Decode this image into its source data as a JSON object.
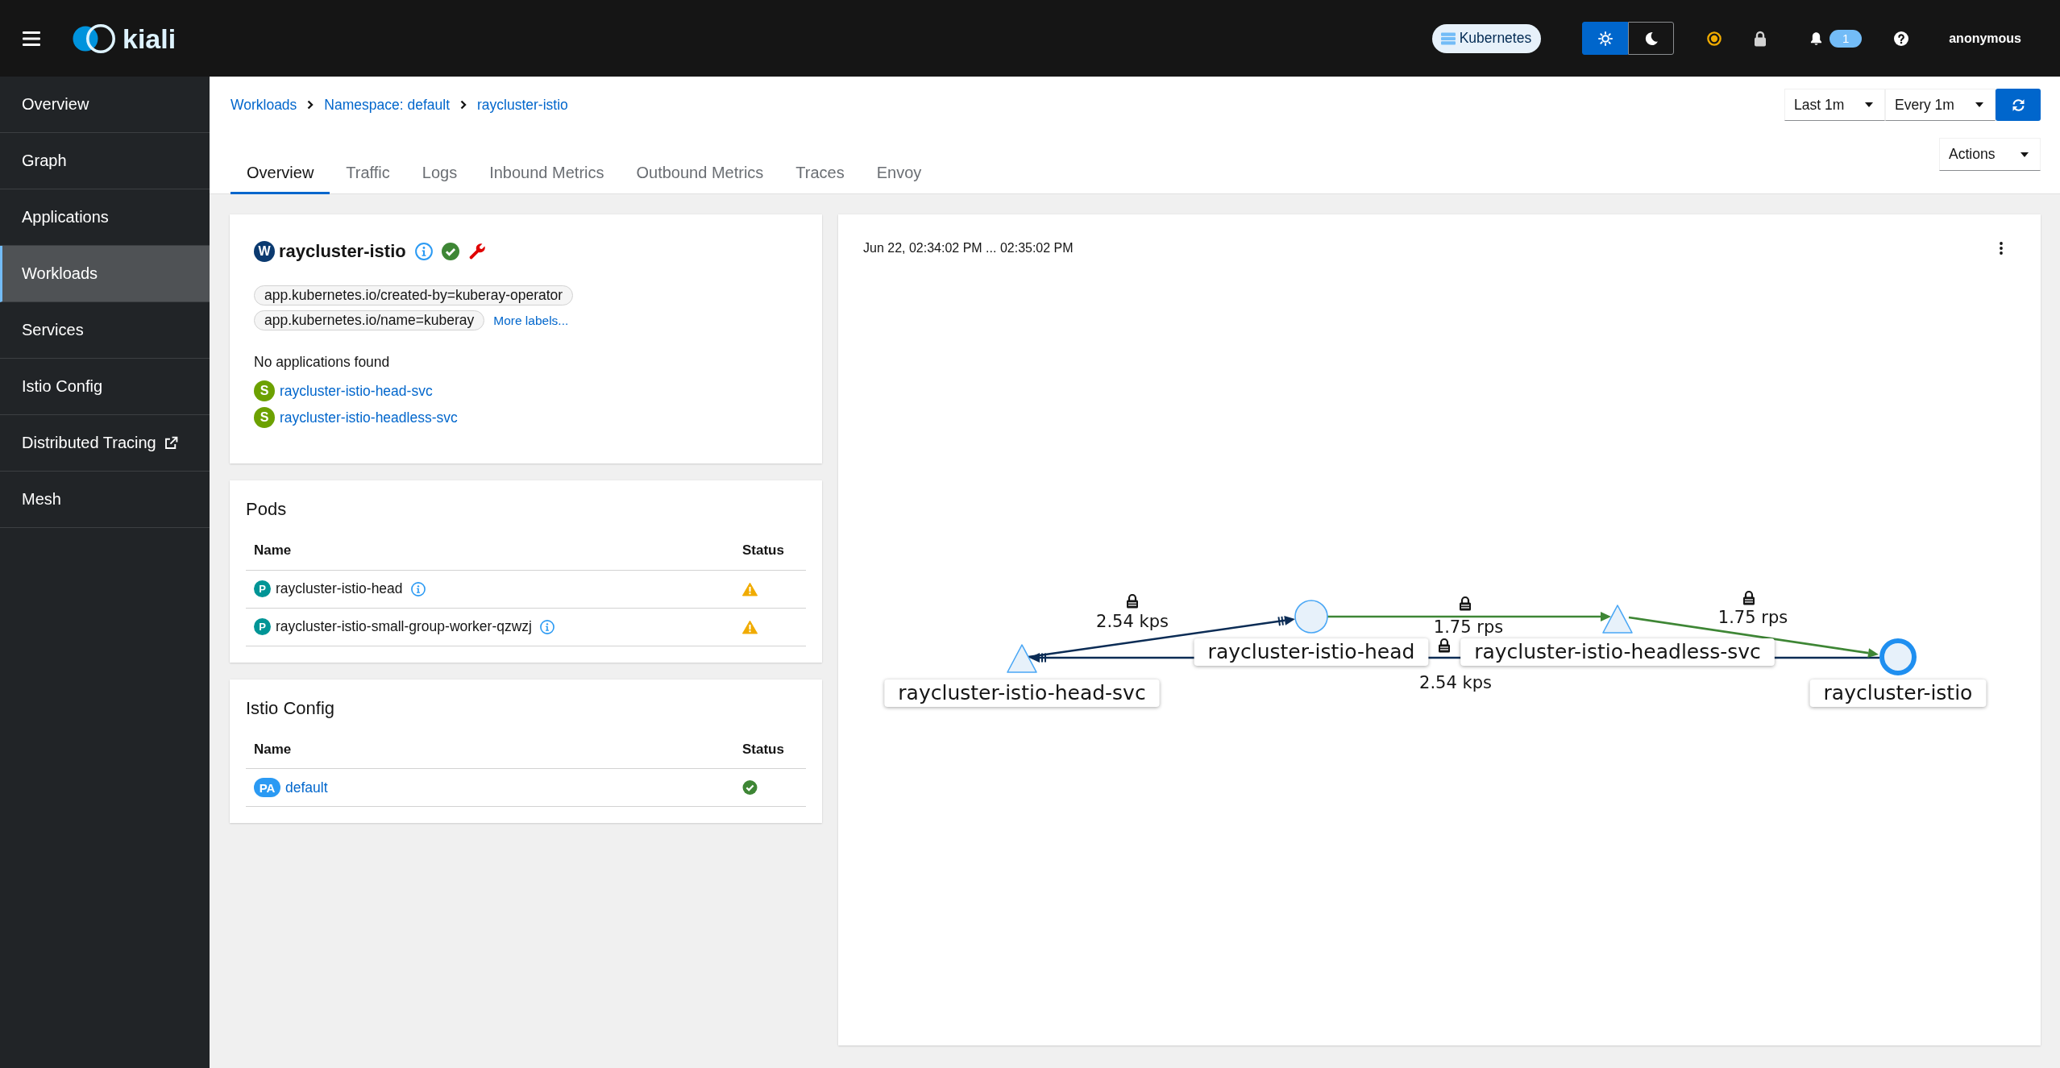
{
  "masthead": {
    "logo_text": "kiali",
    "cluster": "Kubernetes",
    "theme_toggle": [
      {
        "kind": "light",
        "selected": true
      },
      {
        "kind": "dark",
        "selected": false
      }
    ],
    "notification_count": "1",
    "user": "anonymous"
  },
  "sidebar": {
    "items": [
      {
        "label": "Overview",
        "selected": false,
        "external": false
      },
      {
        "label": "Graph",
        "selected": false,
        "external": false
      },
      {
        "label": "Applications",
        "selected": false,
        "external": false
      },
      {
        "label": "Workloads",
        "selected": true,
        "external": false
      },
      {
        "label": "Services",
        "selected": false,
        "external": false
      },
      {
        "label": "Istio Config",
        "selected": false,
        "external": false
      },
      {
        "label": "Distributed Tracing",
        "selected": false,
        "external": true
      },
      {
        "label": "Mesh",
        "selected": false,
        "external": false
      }
    ]
  },
  "breadcrumb": [
    "Workloads",
    "Namespace: default",
    "raycluster-istio"
  ],
  "duration": "Last 1m",
  "refresh_interval": "Every 1m",
  "actions": "Actions",
  "tabs": [
    {
      "label": "Overview",
      "selected": true
    },
    {
      "label": "Traffic",
      "selected": false
    },
    {
      "label": "Logs",
      "selected": false
    },
    {
      "label": "Inbound Metrics",
      "selected": false
    },
    {
      "label": "Outbound Metrics",
      "selected": false
    },
    {
      "label": "Traces",
      "selected": false
    },
    {
      "label": "Envoy",
      "selected": false
    }
  ],
  "workload": {
    "badge": "W",
    "name": "raycluster-istio",
    "healthy": true,
    "labels": [
      "app.kubernetes.io/created-by=kuberay-operator",
      "app.kubernetes.io/name=kuberay"
    ],
    "more_labels": "More labels...",
    "applications": "No applications found",
    "services": [
      {
        "badge": "S",
        "name": "raycluster-istio-head-svc"
      },
      {
        "badge": "S",
        "name": "raycluster-istio-headless-svc"
      }
    ]
  },
  "pods": {
    "title": "Pods",
    "columns": [
      "Name",
      "Status"
    ],
    "rows": [
      {
        "badge": "P",
        "name": "raycluster-istio-head",
        "healthy": false
      },
      {
        "badge": "P",
        "name": "raycluster-istio-small-group-worker-qzwzj",
        "healthy": false
      }
    ]
  },
  "istio_config": {
    "title": "Istio Config",
    "columns": [
      "Name",
      "Status"
    ],
    "rows": [
      {
        "badge": "PA",
        "name": "default",
        "healthy": true
      }
    ]
  },
  "graph": {
    "time_range": "Jun 22, 02:34:02 PM ... 02:35:02 PM",
    "nodes": [
      {
        "label": "raycluster-istio-head-svc",
        "kind": "service",
        "selected": false
      },
      {
        "label": "raycluster-istio-head",
        "kind": "workload",
        "selected": false
      },
      {
        "label": "raycluster-istio-headless-svc",
        "kind": "service",
        "selected": false
      },
      {
        "label": "raycluster-istio",
        "kind": "workload",
        "selected": true
      }
    ],
    "edges": [
      {
        "label": "2.54 kps",
        "kind": "tcp",
        "secure": true
      },
      {
        "label": "1.75 rps",
        "kind": "http",
        "secure": true
      },
      {
        "label": "2.54 kps",
        "kind": "tcp",
        "secure": true
      },
      {
        "label": "1.75 rps",
        "kind": "http",
        "secure": true
      }
    ]
  }
}
